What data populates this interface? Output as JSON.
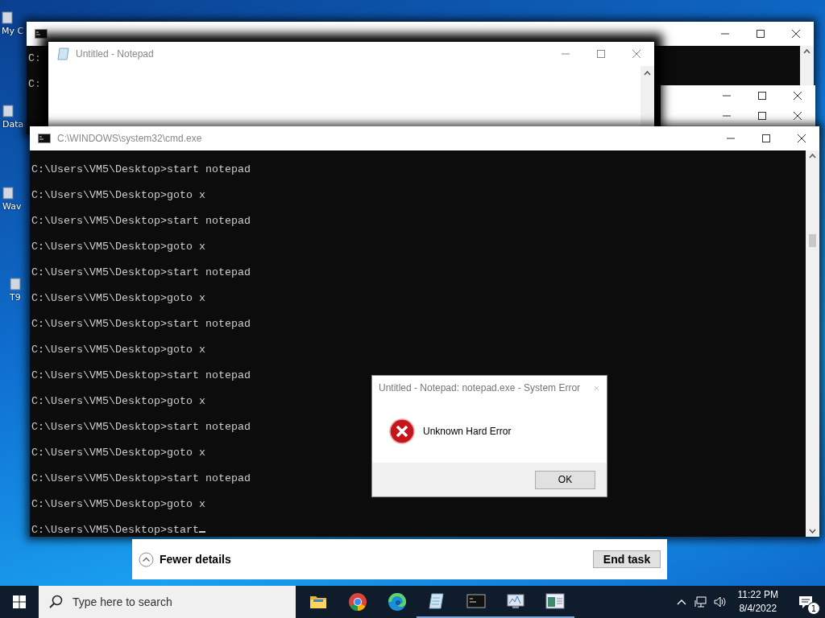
{
  "desktop_icons": [
    {
      "label": "My C"
    },
    {
      "label": "Data"
    },
    {
      "label": "Wav"
    },
    {
      "label": "T9"
    }
  ],
  "back_console": {
    "lines": [
      "C:",
      "C:"
    ]
  },
  "notepad": {
    "title": "Untitled - Notepad"
  },
  "console": {
    "title": "C:\\WINDOWS\\system32\\cmd.exe",
    "lines": [
      "C:\\Users\\VM5\\Desktop>start notepad",
      "C:\\Users\\VM5\\Desktop>goto x",
      "C:\\Users\\VM5\\Desktop>start notepad",
      "C:\\Users\\VM5\\Desktop>goto x",
      "C:\\Users\\VM5\\Desktop>start notepad",
      "C:\\Users\\VM5\\Desktop>goto x",
      "C:\\Users\\VM5\\Desktop>start notepad",
      "C:\\Users\\VM5\\Desktop>goto x",
      "C:\\Users\\VM5\\Desktop>start notepad",
      "C:\\Users\\VM5\\Desktop>goto x",
      "C:\\Users\\VM5\\Desktop>start notepad",
      "C:\\Users\\VM5\\Desktop>goto x",
      "C:\\Users\\VM5\\Desktop>start notepad",
      "C:\\Users\\VM5\\Desktop>goto x",
      "C:\\Users\\VM5\\Desktop>start"
    ]
  },
  "error_dialog": {
    "title": "Untitled - Notepad: notepad.exe - System Error",
    "message": "Unknown Hard Error",
    "button": "OK"
  },
  "task_manager": {
    "toggle": "Fewer details",
    "button": "End task"
  },
  "taskbar": {
    "search": {
      "placeholder": "Type here to search"
    },
    "apps": [
      {
        "kind": "folder",
        "running": false
      },
      {
        "kind": "browser",
        "running": false
      },
      {
        "kind": "edge",
        "running": false
      },
      {
        "kind": "notepad",
        "running": true
      },
      {
        "kind": "console",
        "running": true
      },
      {
        "kind": "monitor",
        "running": true
      },
      {
        "kind": "window",
        "running": true
      }
    ],
    "time": "11:22 PM",
    "date": "8/4/2022",
    "notifications": "1"
  }
}
